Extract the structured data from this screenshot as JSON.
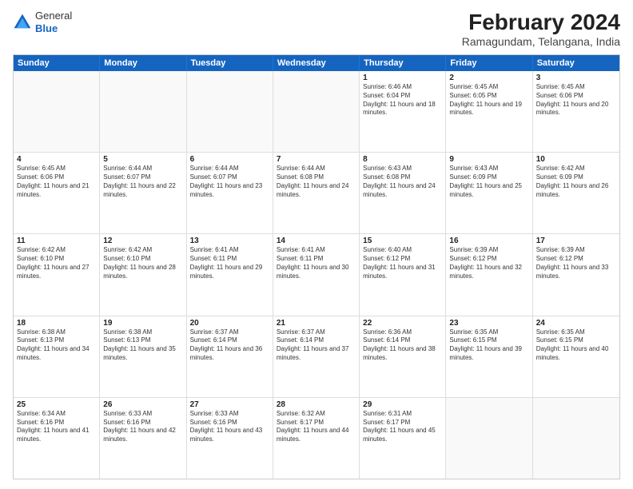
{
  "logo": {
    "general": "General",
    "blue": "Blue"
  },
  "title": "February 2024",
  "subtitle": "Ramagundam, Telangana, India",
  "days": [
    "Sunday",
    "Monday",
    "Tuesday",
    "Wednesday",
    "Thursday",
    "Friday",
    "Saturday"
  ],
  "weeks": [
    [
      {
        "day": "",
        "empty": true
      },
      {
        "day": "",
        "empty": true
      },
      {
        "day": "",
        "empty": true
      },
      {
        "day": "",
        "empty": true
      },
      {
        "day": "1",
        "rise": "6:46 AM",
        "set": "6:04 PM",
        "daylight": "11 hours and 18 minutes."
      },
      {
        "day": "2",
        "rise": "6:45 AM",
        "set": "6:05 PM",
        "daylight": "11 hours and 19 minutes."
      },
      {
        "day": "3",
        "rise": "6:45 AM",
        "set": "6:06 PM",
        "daylight": "11 hours and 20 minutes."
      }
    ],
    [
      {
        "day": "4",
        "rise": "6:45 AM",
        "set": "6:06 PM",
        "daylight": "11 hours and 21 minutes."
      },
      {
        "day": "5",
        "rise": "6:44 AM",
        "set": "6:07 PM",
        "daylight": "11 hours and 22 minutes."
      },
      {
        "day": "6",
        "rise": "6:44 AM",
        "set": "6:07 PM",
        "daylight": "11 hours and 23 minutes."
      },
      {
        "day": "7",
        "rise": "6:44 AM",
        "set": "6:08 PM",
        "daylight": "11 hours and 24 minutes."
      },
      {
        "day": "8",
        "rise": "6:43 AM",
        "set": "6:08 PM",
        "daylight": "11 hours and 24 minutes."
      },
      {
        "day": "9",
        "rise": "6:43 AM",
        "set": "6:09 PM",
        "daylight": "11 hours and 25 minutes."
      },
      {
        "day": "10",
        "rise": "6:42 AM",
        "set": "6:09 PM",
        "daylight": "11 hours and 26 minutes."
      }
    ],
    [
      {
        "day": "11",
        "rise": "6:42 AM",
        "set": "6:10 PM",
        "daylight": "11 hours and 27 minutes."
      },
      {
        "day": "12",
        "rise": "6:42 AM",
        "set": "6:10 PM",
        "daylight": "11 hours and 28 minutes."
      },
      {
        "day": "13",
        "rise": "6:41 AM",
        "set": "6:11 PM",
        "daylight": "11 hours and 29 minutes."
      },
      {
        "day": "14",
        "rise": "6:41 AM",
        "set": "6:11 PM",
        "daylight": "11 hours and 30 minutes."
      },
      {
        "day": "15",
        "rise": "6:40 AM",
        "set": "6:12 PM",
        "daylight": "11 hours and 31 minutes."
      },
      {
        "day": "16",
        "rise": "6:39 AM",
        "set": "6:12 PM",
        "daylight": "11 hours and 32 minutes."
      },
      {
        "day": "17",
        "rise": "6:39 AM",
        "set": "6:12 PM",
        "daylight": "11 hours and 33 minutes."
      }
    ],
    [
      {
        "day": "18",
        "rise": "6:38 AM",
        "set": "6:13 PM",
        "daylight": "11 hours and 34 minutes."
      },
      {
        "day": "19",
        "rise": "6:38 AM",
        "set": "6:13 PM",
        "daylight": "11 hours and 35 minutes."
      },
      {
        "day": "20",
        "rise": "6:37 AM",
        "set": "6:14 PM",
        "daylight": "11 hours and 36 minutes."
      },
      {
        "day": "21",
        "rise": "6:37 AM",
        "set": "6:14 PM",
        "daylight": "11 hours and 37 minutes."
      },
      {
        "day": "22",
        "rise": "6:36 AM",
        "set": "6:14 PM",
        "daylight": "11 hours and 38 minutes."
      },
      {
        "day": "23",
        "rise": "6:35 AM",
        "set": "6:15 PM",
        "daylight": "11 hours and 39 minutes."
      },
      {
        "day": "24",
        "rise": "6:35 AM",
        "set": "6:15 PM",
        "daylight": "11 hours and 40 minutes."
      }
    ],
    [
      {
        "day": "25",
        "rise": "6:34 AM",
        "set": "6:16 PM",
        "daylight": "11 hours and 41 minutes."
      },
      {
        "day": "26",
        "rise": "6:33 AM",
        "set": "6:16 PM",
        "daylight": "11 hours and 42 minutes."
      },
      {
        "day": "27",
        "rise": "6:33 AM",
        "set": "6:16 PM",
        "daylight": "11 hours and 43 minutes."
      },
      {
        "day": "28",
        "rise": "6:32 AM",
        "set": "6:17 PM",
        "daylight": "11 hours and 44 minutes."
      },
      {
        "day": "29",
        "rise": "6:31 AM",
        "set": "6:17 PM",
        "daylight": "11 hours and 45 minutes."
      },
      {
        "day": "",
        "empty": true
      },
      {
        "day": "",
        "empty": true
      }
    ]
  ]
}
